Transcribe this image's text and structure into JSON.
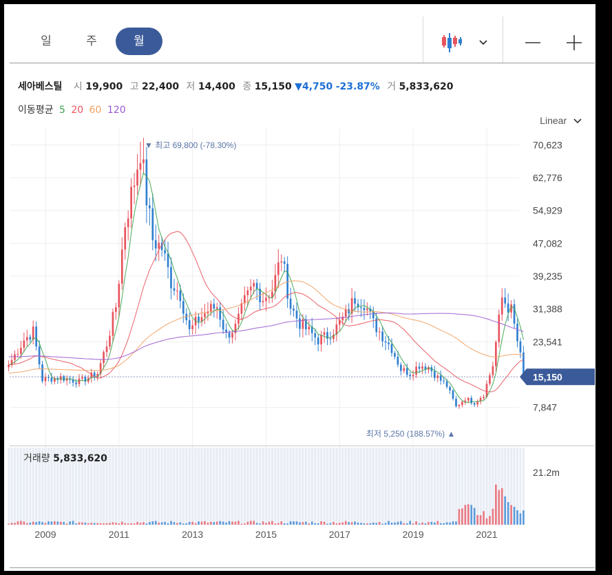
{
  "toolbar": {
    "periods": [
      "일",
      "주",
      "월"
    ],
    "active_period": "월",
    "chart_type_icon": "candlestick-icon",
    "dropdown_icon": "chevron-down-icon",
    "zoom_out_icon": "minus-icon",
    "zoom_in_icon": "plus-icon"
  },
  "info": {
    "name": "세아베스틸",
    "open_label": "시",
    "open": "19,900",
    "high_label": "고",
    "high": "22,400",
    "low_label": "저",
    "low": "14,400",
    "close_label": "종",
    "close": "15,150",
    "change_arrow": "▼",
    "change": "4,750",
    "change_pct": "-23.87%",
    "volume_label": "거",
    "volume": "5,833,620"
  },
  "ma": {
    "label": "이동평균",
    "periods": [
      {
        "text": "5",
        "color": "#3aa34a"
      },
      {
        "text": "20",
        "color": "#e8535d"
      },
      {
        "text": "60",
        "color": "#f0a060"
      },
      {
        "text": "120",
        "color": "#9b59d0"
      }
    ]
  },
  "scale": {
    "label": "Linear"
  },
  "annotations": {
    "high": {
      "arrow": "▼",
      "label": "최고",
      "value": "69,800 (-78.30%)"
    },
    "low": {
      "label": "최저",
      "value": "5,250 (188.57%)",
      "arrow": "▲"
    }
  },
  "volume_panel": {
    "label": "거래량",
    "value": "5,833,620",
    "axis_label": "21.2m"
  },
  "colors": {
    "up": "#e8535d",
    "down": "#2f7fd0",
    "accent": "#3b5a99",
    "ma5": "#3aa34a",
    "ma20": "#e8535d",
    "ma60": "#f0a060",
    "ma120": "#9b59d0"
  },
  "chart_data": {
    "type": "candlestick",
    "interval": "monthly",
    "y_ticks": [
      "70,623",
      "62,776",
      "54,929",
      "47,082",
      "39,235",
      "31,388",
      "23,541",
      "15,150",
      "7,847"
    ],
    "last_price_label": "15,150",
    "x_ticks": [
      "2009",
      "2011",
      "2013",
      "2015",
      "2017",
      "2019",
      "2021"
    ],
    "ylim": [
      3500,
      73000
    ],
    "price_path": [
      [
        "2008-01",
        18000
      ],
      [
        "2008-06",
        24000
      ],
      [
        "2008-09",
        26000
      ],
      [
        "2008-12",
        14500
      ],
      [
        "2009-06",
        15000
      ],
      [
        "2009-12",
        14000
      ],
      [
        "2010-06",
        16000
      ],
      [
        "2010-09",
        23000
      ],
      [
        "2010-12",
        32000
      ],
      [
        "2011-03",
        52000
      ],
      [
        "2011-06",
        62000
      ],
      [
        "2011-08",
        69800
      ],
      [
        "2011-10",
        58000
      ],
      [
        "2011-12",
        48000
      ],
      [
        "2012-03",
        46000
      ],
      [
        "2012-06",
        38000
      ],
      [
        "2012-09",
        35000
      ],
      [
        "2012-12",
        26000
      ],
      [
        "2013-03",
        29000
      ],
      [
        "2013-06",
        31000
      ],
      [
        "2013-09",
        32000
      ],
      [
        "2013-12",
        25000
      ],
      [
        "2014-03",
        27000
      ],
      [
        "2014-06",
        33000
      ],
      [
        "2014-09",
        37000
      ],
      [
        "2014-12",
        34000
      ],
      [
        "2015-03",
        36000
      ],
      [
        "2015-06",
        44000
      ],
      [
        "2015-09",
        32000
      ],
      [
        "2015-12",
        28000
      ],
      [
        "2016-03",
        26000
      ],
      [
        "2016-06",
        24000
      ],
      [
        "2016-09",
        25000
      ],
      [
        "2016-12",
        27000
      ],
      [
        "2017-03",
        30000
      ],
      [
        "2017-06",
        34000
      ],
      [
        "2017-09",
        33000
      ],
      [
        "2017-12",
        28000
      ],
      [
        "2018-03",
        25000
      ],
      [
        "2018-06",
        22000
      ],
      [
        "2018-09",
        17000
      ],
      [
        "2018-12",
        16000
      ],
      [
        "2019-03",
        18000
      ],
      [
        "2019-06",
        17500
      ],
      [
        "2019-09",
        15000
      ],
      [
        "2019-12",
        13000
      ],
      [
        "2020-03",
        8000
      ],
      [
        "2020-06",
        10000
      ],
      [
        "2020-09",
        9000
      ],
      [
        "2020-12",
        11000
      ],
      [
        "2021-03",
        18000
      ],
      [
        "2021-06",
        34000
      ],
      [
        "2021-09",
        31000
      ],
      [
        "2021-12",
        20000
      ],
      [
        "2022-01",
        15150
      ]
    ],
    "ma_series": [
      {
        "name": "5",
        "window": 5
      },
      {
        "name": "20",
        "window": 20
      },
      {
        "name": "60",
        "window": 60
      },
      {
        "name": "120",
        "window": 120
      }
    ],
    "volume_max": 21200000,
    "last_volume": 5833620
  }
}
